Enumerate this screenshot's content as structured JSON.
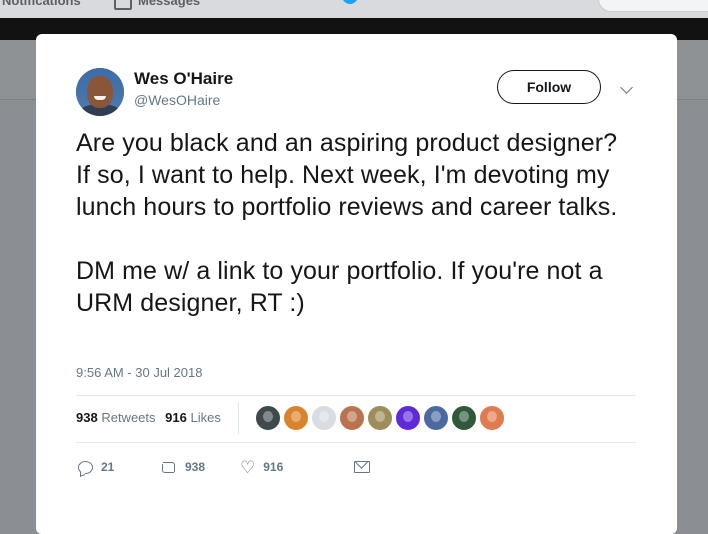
{
  "topbar": {
    "notifications_label": "Notifications",
    "messages_label": "Messages"
  },
  "tweet": {
    "author": {
      "name": "Wes O'Haire",
      "handle": "@WesOHaire"
    },
    "follow_label": "Follow",
    "text": "Are you black and an aspiring product designer? If so, I want to help. Next week, I'm devoting my lunch hours to portfolio reviews and career talks.\n\nDM me w/ a link to your portfolio. If you're not a URM designer, RT :)",
    "timestamp": "9:56 AM - 30 Jul 2018",
    "stats": {
      "retweets_count": "938",
      "retweets_label": "Retweets",
      "likes_count": "916",
      "likes_label": "Likes"
    },
    "liker_avatar_colors": [
      "#3f4a4f",
      "#d9832b",
      "#d7dde3",
      "#b9744f",
      "#9e8c5a",
      "#5f2bd6",
      "#4d6aa0",
      "#2f5a3a",
      "#e07a4f"
    ],
    "actions": {
      "reply_count": "21",
      "retweet_count": "938",
      "like_count": "916"
    }
  },
  "colors": {
    "accent": "#1da1f2",
    "text_primary": "#14171a",
    "text_secondary": "#657786",
    "divider": "#e1e8ed"
  }
}
